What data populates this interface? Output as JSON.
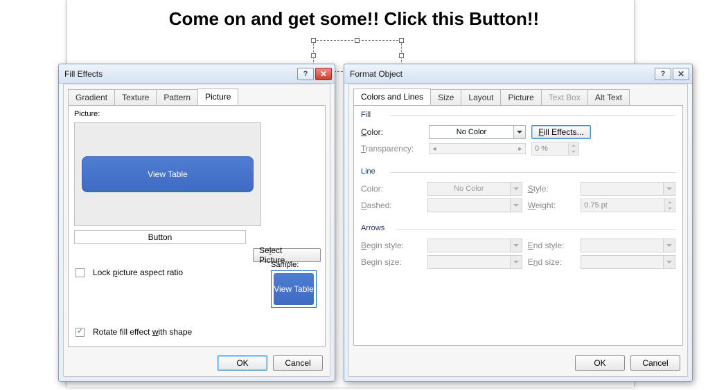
{
  "headline": "Come on and get some!! Click this Button!!",
  "fill_effects": {
    "title": "Fill Effects",
    "tabs": [
      "Gradient",
      "Texture",
      "Pattern",
      "Picture"
    ],
    "active_tab": 3,
    "picture_label": "Picture:",
    "preview_button_text": "View Table",
    "picture_name": "Button",
    "select_picture_btn": "Select Picture...",
    "lock_aspect_label": "Lock picture aspect ratio",
    "lock_aspect_checked": false,
    "rotate_label": "Rotate fill effect with shape",
    "rotate_checked": true,
    "sample_label": "Sample:",
    "sample_text": "View Table",
    "ok_label": "OK",
    "cancel_label": "Cancel"
  },
  "format_object": {
    "title": "Format Object",
    "tabs": [
      "Colors and Lines",
      "Size",
      "Layout",
      "Picture",
      "Text Box",
      "Alt Text"
    ],
    "active_tab": 0,
    "disabled_tabs": [
      4
    ],
    "fill": {
      "legend": "Fill",
      "color_label": "Color:",
      "color_value": "No Color",
      "fill_effects_btn": "Fill Effects...",
      "transparency_label": "Transparency:",
      "transparency_value": "0 %"
    },
    "line": {
      "legend": "Line",
      "color_label": "Color:",
      "color_value": "No Color",
      "dashed_label": "Dashed:",
      "style_label": "Style:",
      "weight_label": "Weight:",
      "weight_value": "0.75 pt"
    },
    "arrows": {
      "legend": "Arrows",
      "begin_style_label": "Begin style:",
      "begin_size_label": "Begin size:",
      "end_style_label": "End style:",
      "end_size_label": "End size:"
    },
    "ok_label": "OK",
    "cancel_label": "Cancel"
  }
}
